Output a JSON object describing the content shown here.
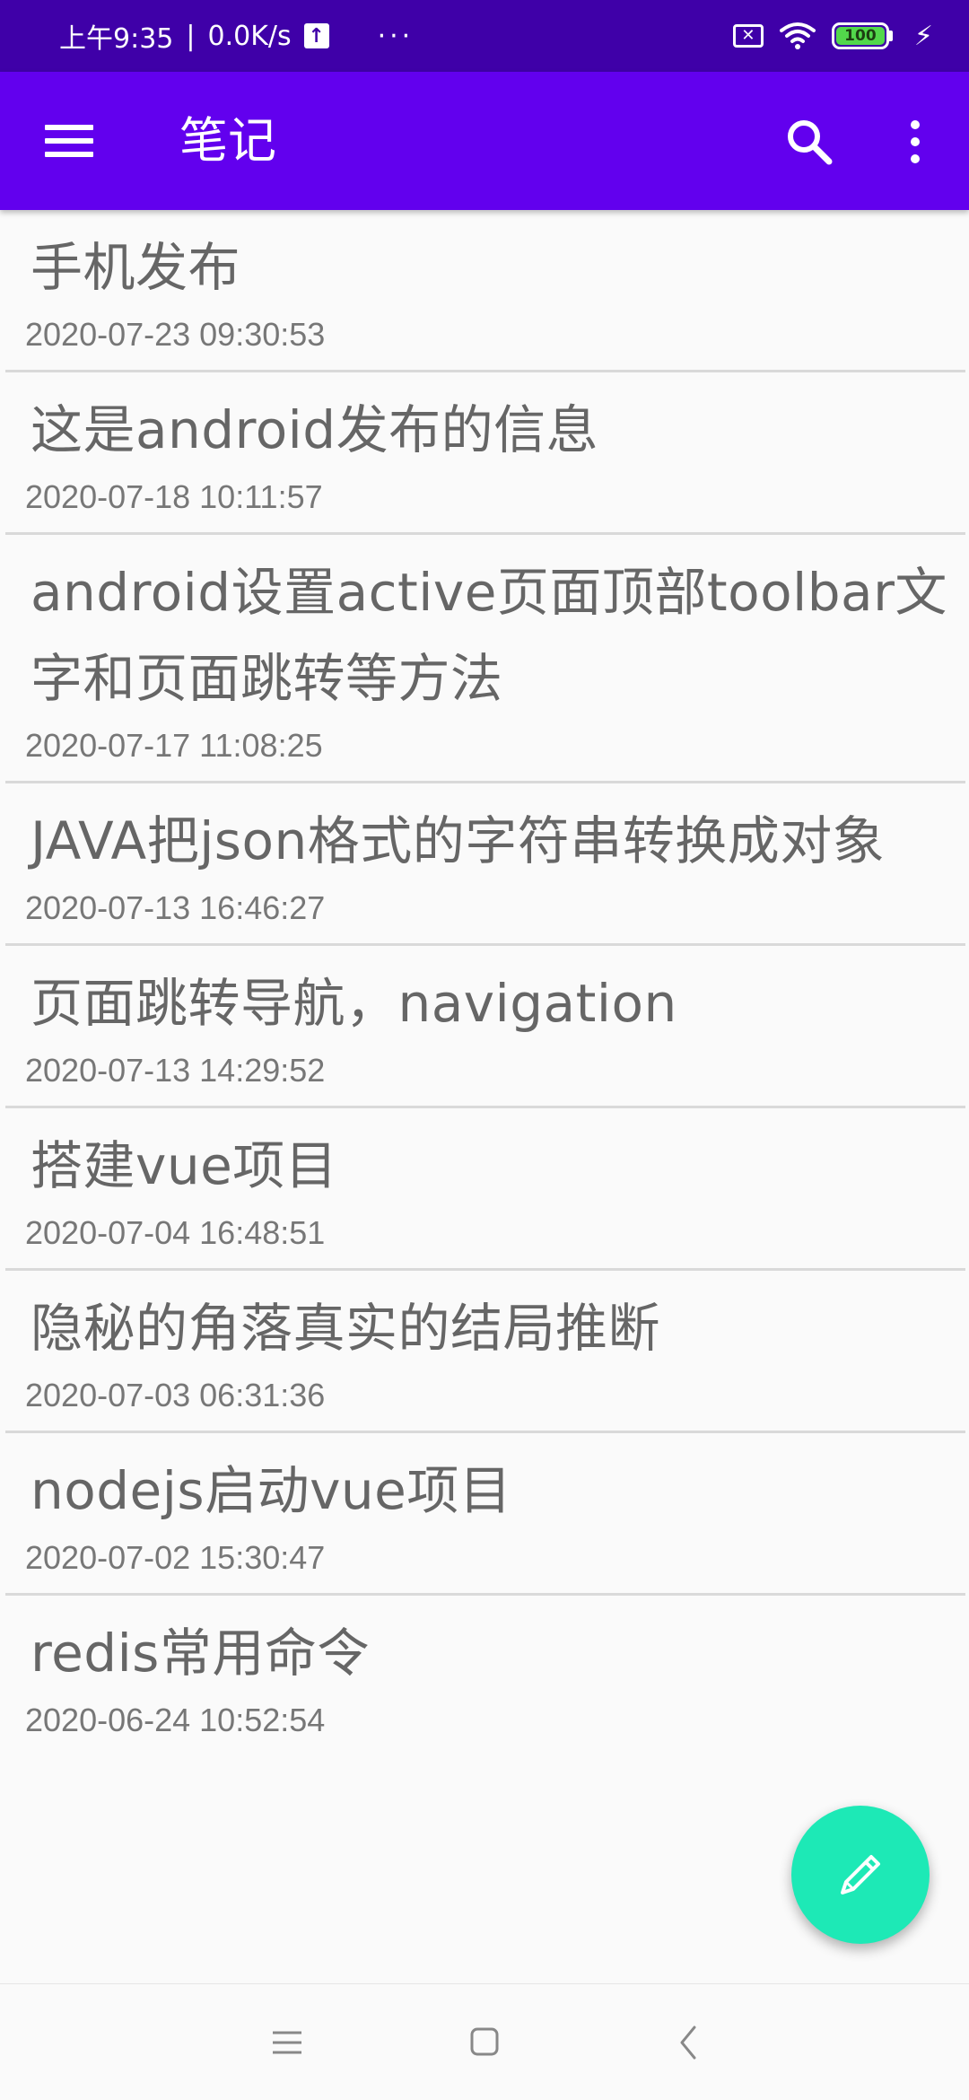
{
  "status_bar": {
    "time": "上午9:35",
    "separator": "|",
    "network_speed": "0.0K/s",
    "upload_icon": "upload-arrow-icon",
    "more_dots": "···",
    "battery_level": "100",
    "icons": [
      "sim-off-icon",
      "wifi-icon",
      "battery-icon",
      "charging-bolt-icon"
    ]
  },
  "app_bar": {
    "title": "笔记",
    "menu_icon": "hamburger-menu-icon",
    "search_icon": "search-icon",
    "more_icon": "more-vertical-icon",
    "background": "#6200ee"
  },
  "notes": [
    {
      "title": "手机发布",
      "date": "2020-07-23 09:30:53"
    },
    {
      "title": "这是android发布的信息",
      "date": "2020-07-18 10:11:57"
    },
    {
      "title": "android设置active页面顶部toolbar文字和页面跳转等方法",
      "date": "2020-07-17 11:08:25"
    },
    {
      "title": "JAVA把json格式的字符串转换成对象",
      "date": "2020-07-13 16:46:27"
    },
    {
      "title": "页面跳转导航，navigation",
      "date": "2020-07-13 14:29:52"
    },
    {
      "title": "搭建vue项目",
      "date": "2020-07-04 16:48:51"
    },
    {
      "title": "隐秘的角落真实的结局推断",
      "date": "2020-07-03 06:31:36"
    },
    {
      "title": "nodejs启动vue项目",
      "date": "2020-07-02 15:30:47"
    },
    {
      "title": "redis常用命令",
      "date": "2020-06-24 10:52:54"
    }
  ],
  "fab": {
    "icon": "pencil-icon",
    "color": "#1de9b6"
  },
  "nav_bar": {
    "icons": [
      "recents-icon",
      "home-icon",
      "back-icon"
    ]
  }
}
